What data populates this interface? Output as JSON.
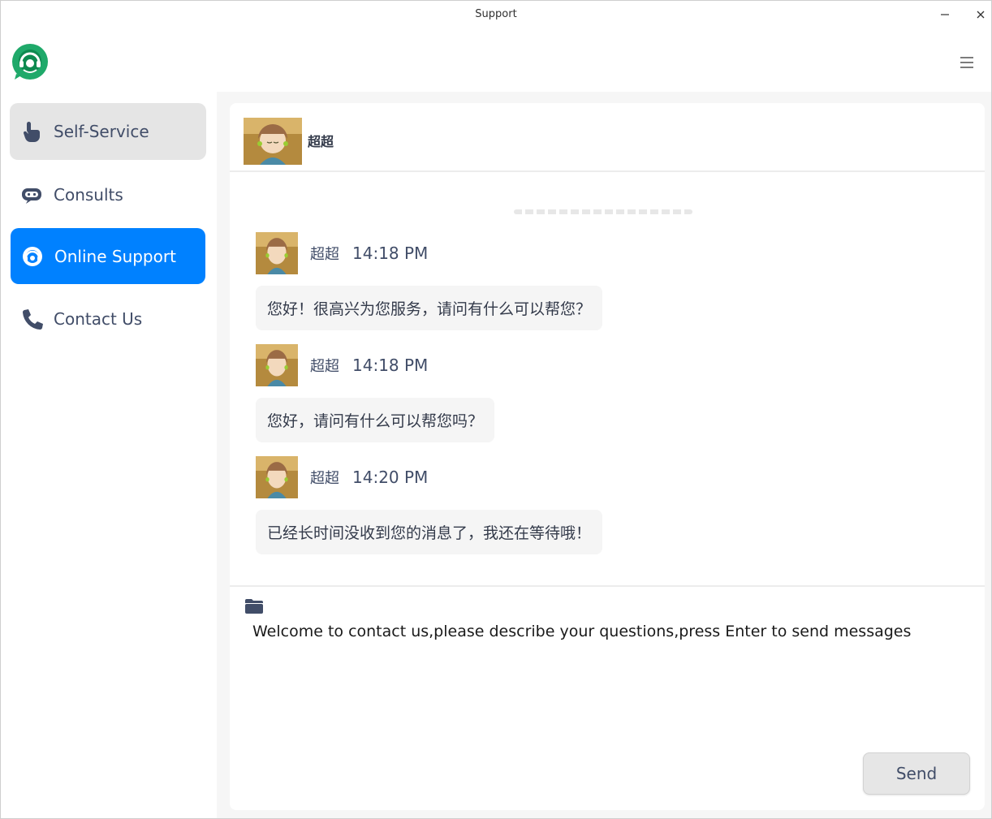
{
  "window": {
    "title": "Support"
  },
  "sidebar": {
    "items": [
      {
        "label": "Self-Service",
        "icon": "hand-pointer-icon"
      },
      {
        "label": "Consults",
        "icon": "chat-bot-icon"
      },
      {
        "label": "Online Support",
        "icon": "headset-icon"
      },
      {
        "label": "Contact Us",
        "icon": "phone-icon"
      }
    ],
    "active_index": 2
  },
  "chat": {
    "contact_name": "超超",
    "messages": [
      {
        "sender": "超超",
        "time": "14:18 PM",
        "text": "您好！很高兴为您服务，请问有什么可以帮您？"
      },
      {
        "sender": "超超",
        "time": "14:18 PM",
        "text": "您好，请问有什么可以帮您吗？"
      },
      {
        "sender": "超超",
        "time": "14:20 PM",
        "text": "已经长时间没收到您的消息了，我还在等待哦！"
      }
    ]
  },
  "composer": {
    "placeholder": "Welcome to contact us,please describe your questions,press Enter to send messages",
    "send_label": "Send"
  },
  "colors": {
    "accent": "#0081ff",
    "logo_green": "#1fa96a",
    "active_gray": "#e5e5e5"
  }
}
